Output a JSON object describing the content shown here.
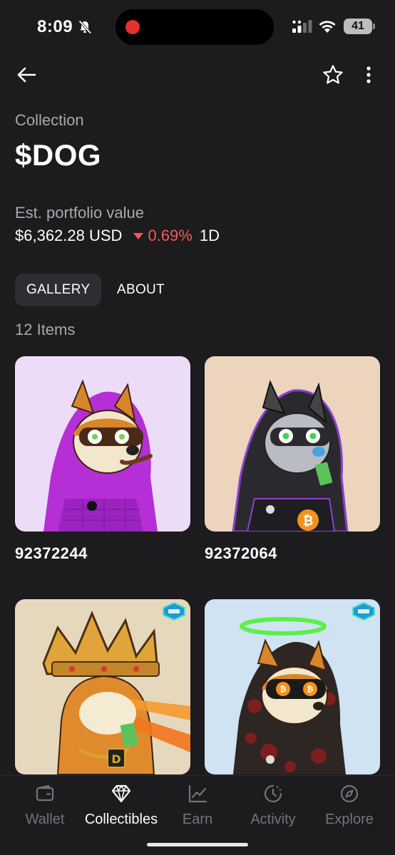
{
  "status_bar": {
    "time": "8:09",
    "battery": "41"
  },
  "header": {
    "eyebrow": "Collection",
    "title": "$DOG"
  },
  "portfolio": {
    "label": "Est. portfolio value",
    "amount": "$6,362.28 USD",
    "change": "0.69%",
    "change_direction": "down",
    "period": "1D",
    "negative_color": "#ef5a5a"
  },
  "tabs": [
    {
      "label": "GALLERY",
      "active": true
    },
    {
      "label": "ABOUT",
      "active": false
    }
  ],
  "gallery": {
    "count_label": "12 Items",
    "items": [
      {
        "name": "92372244",
        "bg": "#eddcf8",
        "hood": "#b52ed6",
        "eyes": "stars"
      },
      {
        "name": "92372064",
        "bg": "#ecd4bd",
        "hood": "#2a2a2e",
        "eyes": "stars"
      },
      {
        "name": "",
        "bg": "#e6d8bd",
        "hood": "#d8781e",
        "eyes": "lasers"
      },
      {
        "name": "",
        "bg": "#cfe3f3",
        "hood": "#2d2622",
        "eyes": "bitcoin"
      }
    ]
  },
  "tabbar": [
    {
      "label": "Wallet",
      "icon": "wallet-icon",
      "active": false
    },
    {
      "label": "Collectibles",
      "icon": "gem-icon",
      "active": true
    },
    {
      "label": "Earn",
      "icon": "chart-icon",
      "active": false
    },
    {
      "label": "Activity",
      "icon": "clock-icon",
      "active": false
    },
    {
      "label": "Explore",
      "icon": "compass-icon",
      "active": false
    }
  ]
}
